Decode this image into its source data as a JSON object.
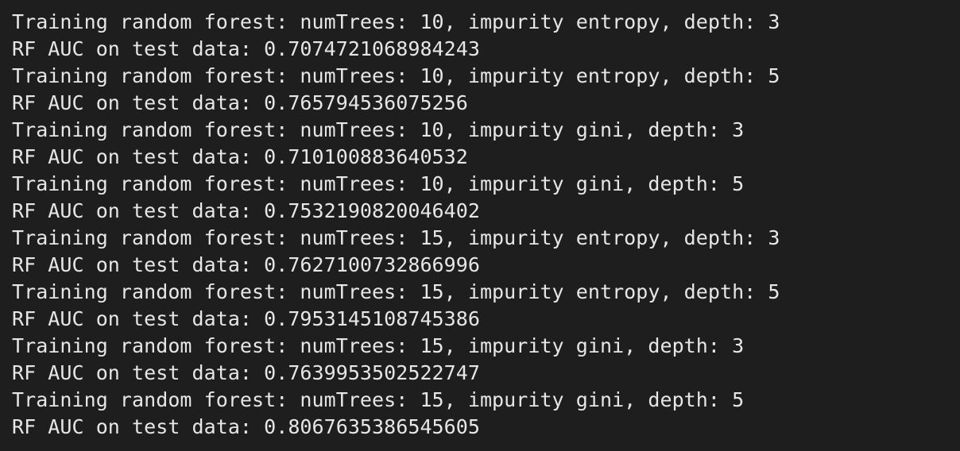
{
  "terminal": {
    "lines": [
      "Training random forest: numTrees: 10, impurity entropy, depth: 3",
      "RF AUC on test data: 0.7074721068984243",
      "Training random forest: numTrees: 10, impurity entropy, depth: 5",
      "RF AUC on test data: 0.765794536075256",
      "Training random forest: numTrees: 10, impurity gini, depth: 3",
      "RF AUC on test data: 0.710100883640532",
      "Training random forest: numTrees: 10, impurity gini, depth: 5",
      "RF AUC on test data: 0.7532190820046402",
      "Training random forest: numTrees: 15, impurity entropy, depth: 3",
      "RF AUC on test data: 0.7627100732866996",
      "Training random forest: numTrees: 15, impurity entropy, depth: 5",
      "RF AUC on test data: 0.7953145108745386",
      "Training random forest: numTrees: 15, impurity gini, depth: 3",
      "RF AUC on test data: 0.7639953502522747",
      "Training random forest: numTrees: 15, impurity gini, depth: 5",
      "RF AUC on test data: 0.8067635386545605"
    ]
  },
  "colors": {
    "background": "#1e1e1e",
    "text": "#e6e6e6"
  }
}
